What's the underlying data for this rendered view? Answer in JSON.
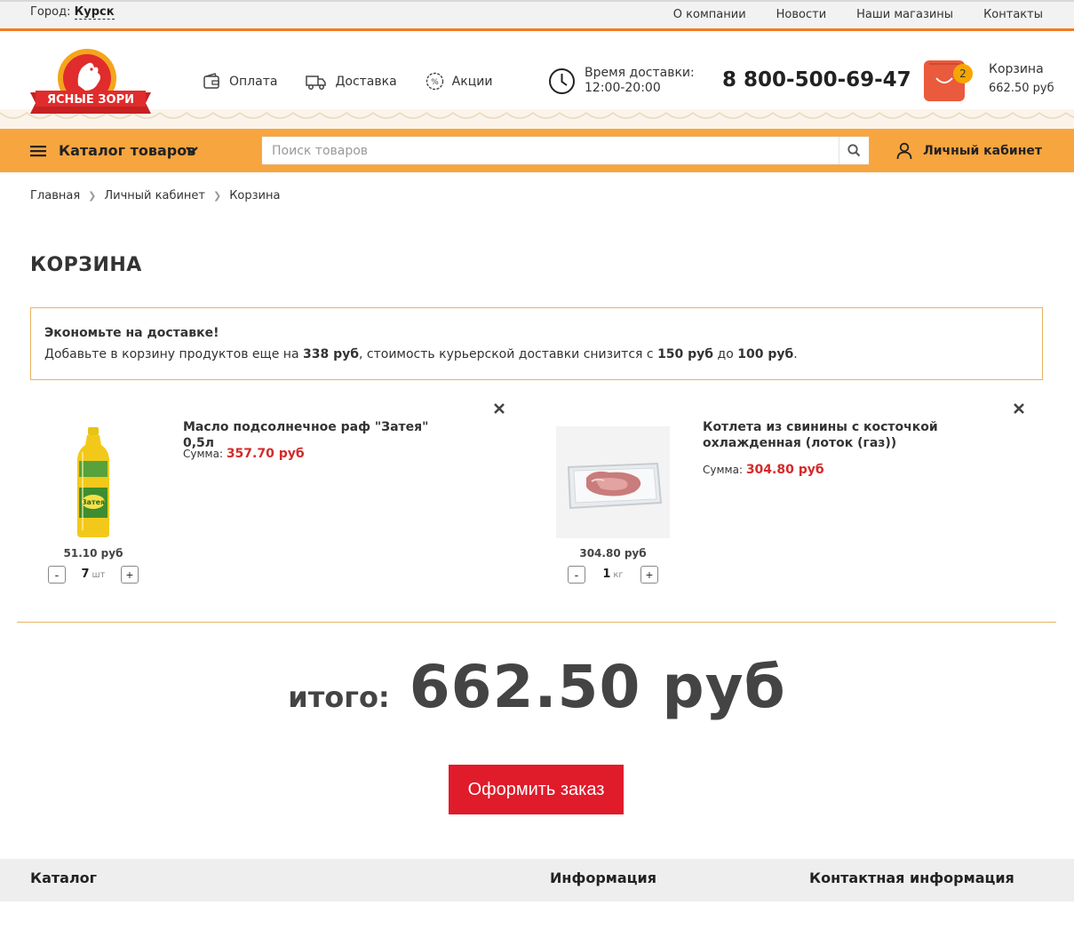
{
  "topbar": {
    "city_label": "Город:",
    "city_value": "Курск",
    "links": [
      "О компании",
      "Новости",
      "Наши магазины",
      "Контакты"
    ]
  },
  "header": {
    "logo_text": "ЯСНЫЕ ЗОРИ",
    "links": {
      "payment": "Оплата",
      "delivery": "Доставка",
      "promo": "Акции"
    },
    "delivery_time_label": "Время доставки:",
    "delivery_time_value": "12:00-20:00",
    "phone": "8 800-500-69-47",
    "cart_label": "Корзина",
    "cart_sum": "662.50 руб",
    "cart_count": "2"
  },
  "navbar": {
    "catalog_label": "Каталог товаров",
    "search_placeholder": "Поиск товаров",
    "account_label": "Личный кабинет"
  },
  "breadcrumb": [
    "Главная",
    "Личный кабинет",
    "Корзина"
  ],
  "page_title": "КОРЗИНА",
  "notice": {
    "title": "Экономьте на доставке!",
    "text_1": "Добавьте в корзину продуктов еще на ",
    "amount": "338 руб",
    "text_2": ", стоимость курьерской доставки снизится с ",
    "from": "150 руб",
    "text_3": " до ",
    "to": "100 руб",
    "text_4": "."
  },
  "items": [
    {
      "name": "Масло подсолнечное раф \"Затея\" 0,5л",
      "sum_label": "Сумма:",
      "sum": "357.70 руб",
      "unit_price": "51.10 руб",
      "qty": "7",
      "unit": "шт",
      "image": "oil-bottle"
    },
    {
      "name": "Котлета из свинины с косточкой охлажденная (лоток (газ))",
      "sum_label": "Сумма:",
      "sum": "304.80 руб",
      "unit_price": "304.80 руб",
      "qty": "1",
      "unit": "кг",
      "image": "meat-tray"
    }
  ],
  "total": {
    "label": "итого:",
    "value": "662.50 руб"
  },
  "order_button": "Оформить заказ",
  "footer": {
    "catalog": "Каталог",
    "info": "Информация",
    "contacts": "Контактная информация"
  },
  "colors": {
    "accent_orange": "#f7a53f",
    "price_red": "#d42a2a",
    "order_button": "#e01b2a",
    "cart_bag": "#ea5a3d"
  }
}
